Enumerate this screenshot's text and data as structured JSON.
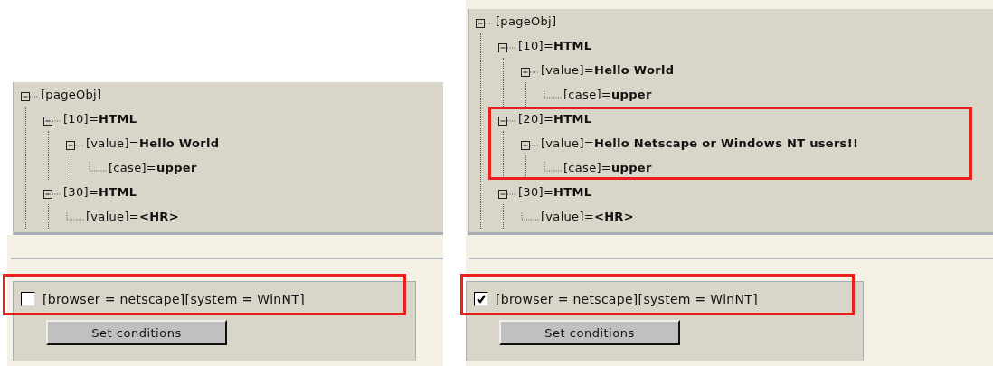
{
  "panels": [
    {
      "tree": {
        "label": "[pageObj]",
        "highlighted": false,
        "children": [
          {
            "label": "[10]=**HTML**",
            "highlighted": false,
            "children": [
              {
                "label": "[value]=**Hello World**",
                "highlighted": false,
                "children": [
                  {
                    "label": "[case]=**upper**",
                    "highlighted": false
                  }
                ]
              }
            ]
          },
          {
            "label": "[30]=**HTML**",
            "highlighted": false,
            "children": [
              {
                "label": "[value]=**<HR>**",
                "highlighted": false
              }
            ]
          }
        ]
      },
      "condition": {
        "label": "[browser = netscape][system = WinNT]",
        "checked": false,
        "highlighted": true
      },
      "button": "Set conditions"
    },
    {
      "tree": {
        "label": "[pageObj]",
        "highlighted": false,
        "children": [
          {
            "label": "[10]=**HTML**",
            "highlighted": false,
            "children": [
              {
                "label": "[value]=**Hello World**",
                "highlighted": false,
                "children": [
                  {
                    "label": "[case]=**upper**",
                    "highlighted": false
                  }
                ]
              }
            ]
          },
          {
            "label": "[20]=**HTML**",
            "highlighted": true,
            "children": [
              {
                "label": "[value]=**Hello Netscape or Windows NT users!!**",
                "highlighted": false,
                "children": [
                  {
                    "label": "[case]=**upper**",
                    "highlighted": false
                  }
                ]
              }
            ]
          },
          {
            "label": "[30]=**HTML**",
            "highlighted": false,
            "children": [
              {
                "label": "[value]=**<HR>**",
                "highlighted": false
              }
            ]
          }
        ]
      },
      "condition": {
        "label": "[browser = netscape][system = WinNT]",
        "checked": true,
        "highlighted": true
      },
      "button": "Set conditions"
    }
  ]
}
